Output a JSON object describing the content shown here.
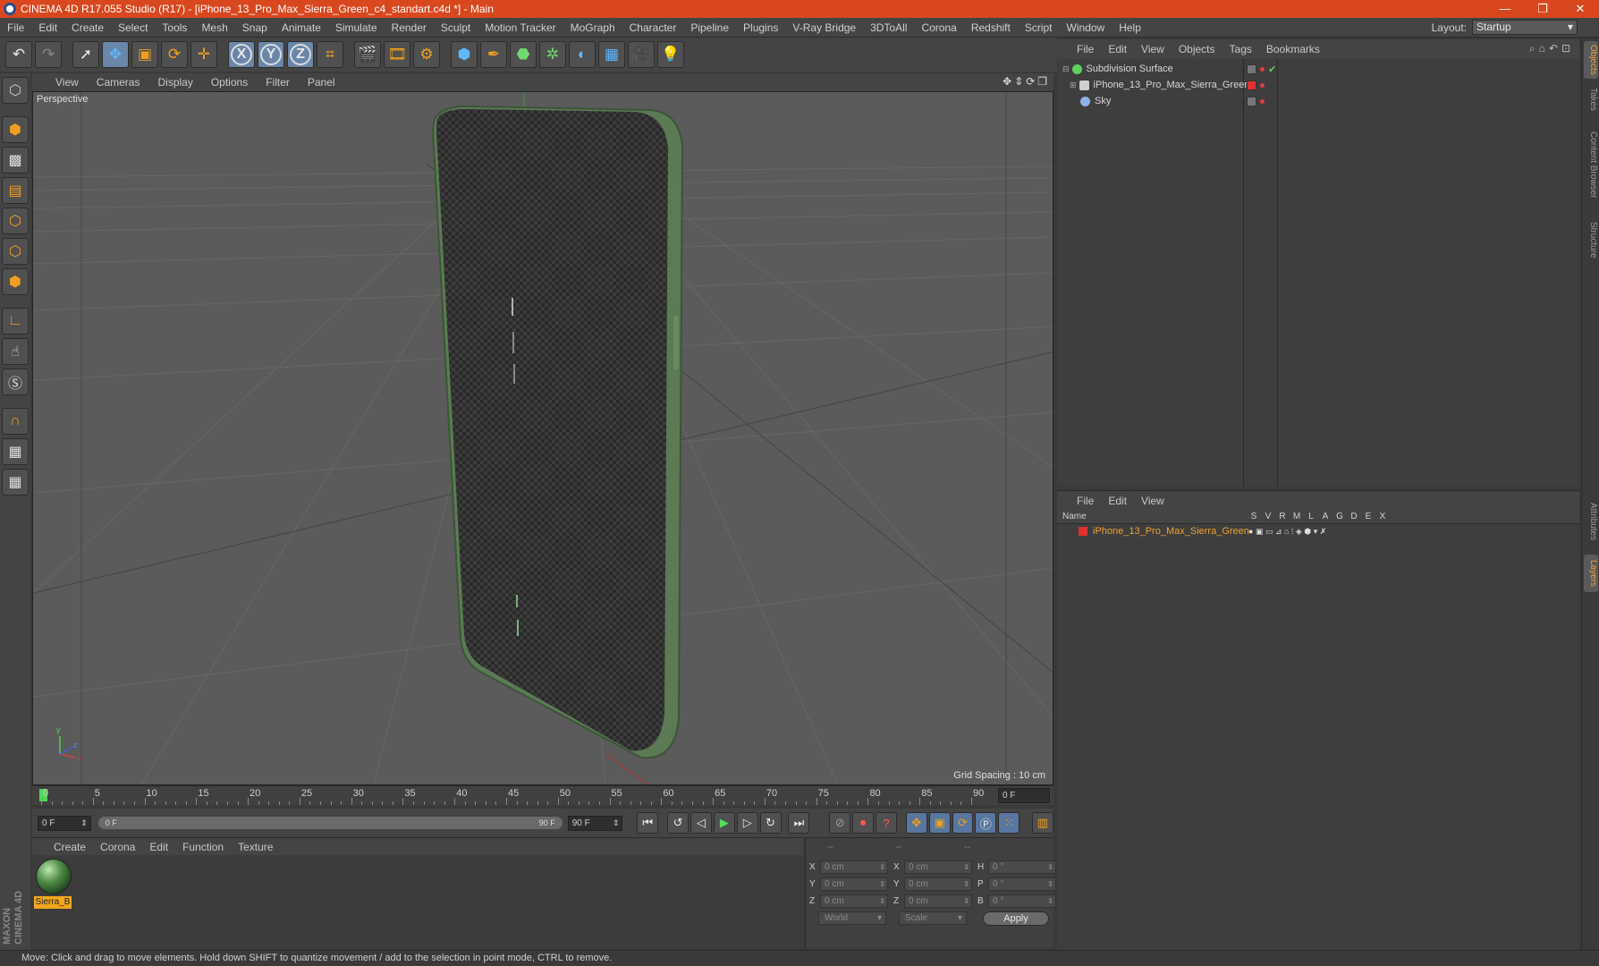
{
  "window": {
    "title": "CINEMA 4D R17.055 Studio (R17) - [iPhone_13_Pro_Max_Sierra_Green_c4_standart.c4d *] - Main",
    "minimize": "—",
    "restore": "❐",
    "close": "✕"
  },
  "menubar": {
    "items": [
      "File",
      "Edit",
      "Create",
      "Select",
      "Tools",
      "Mesh",
      "Snap",
      "Animate",
      "Simulate",
      "Render",
      "Sculpt",
      "Motion Tracker",
      "MoGraph",
      "Character",
      "Pipeline",
      "Plugins",
      "V-Ray Bridge",
      "3DToAll",
      "Corona",
      "Redshift",
      "Script",
      "Window",
      "Help"
    ],
    "layout_label": "Layout:",
    "layout_value": "Startup"
  },
  "toolbar": {
    "icons": [
      "undo-icon",
      "redo-icon",
      "select-icon",
      "move-icon",
      "scale-icon",
      "rotate-icon",
      "live-move-icon",
      "x-axis-icon",
      "y-axis-icon",
      "z-axis-icon",
      "world-coords-icon",
      "render-view-icon",
      "render-picture-queue-icon",
      "render-settings-icon",
      "cube-icon",
      "pen-icon",
      "subdivision-icon",
      "array-icon",
      "deformer-icon",
      "floor-icon",
      "camera-icon",
      "light-icon"
    ],
    "axis_labels": [
      "X",
      "Y",
      "Z"
    ]
  },
  "viewport": {
    "menu": [
      "View",
      "Cameras",
      "Display",
      "Options",
      "Filter",
      "Panel"
    ],
    "label": "Perspective",
    "grid_spacing": "Grid Spacing : 10 cm",
    "axis_y": "y",
    "axis_x": "x",
    "axis_z": "z"
  },
  "timeline": {
    "ticks": [
      "0",
      "5",
      "10",
      "15",
      "20",
      "25",
      "30",
      "35",
      "40",
      "45",
      "50",
      "55",
      "60",
      "65",
      "70",
      "75",
      "80",
      "85",
      "90"
    ],
    "current_frame": "0 F"
  },
  "playback": {
    "start_field": "0 F",
    "range_start": "0 F",
    "range_end": "90 F",
    "end_field": "90 F"
  },
  "material_manager": {
    "menu": [
      "Create",
      "Corona",
      "Edit",
      "Function",
      "Texture"
    ],
    "material_name": "Sierra_B"
  },
  "coordinates": {
    "header": [
      "--",
      "--",
      "--"
    ],
    "rows": [
      {
        "a": "X",
        "av": "0 cm",
        "b": "X",
        "bv": "0 cm",
        "c": "H",
        "cv": "0 °"
      },
      {
        "a": "Y",
        "av": "0 cm",
        "b": "Y",
        "bv": "0 cm",
        "c": "P",
        "cv": "0 °"
      },
      {
        "a": "Z",
        "av": "0 cm",
        "b": "Z",
        "bv": "0 cm",
        "c": "B",
        "cv": "0 °"
      }
    ],
    "mode": "World",
    "type": "Scale",
    "apply": "Apply"
  },
  "object_manager": {
    "menu": [
      "File",
      "Edit",
      "View",
      "Objects",
      "Tags",
      "Bookmarks"
    ],
    "objects": [
      {
        "name": "Subdivision Surface",
        "color": "#5fd05f"
      },
      {
        "name": "iPhone_13_Pro_Max_Sierra_Green",
        "color": "#cfcfcf"
      },
      {
        "name": "Sky",
        "color": "#8ab4e6"
      }
    ]
  },
  "layer_manager": {
    "menu": [
      "File",
      "Edit",
      "View"
    ],
    "columns": [
      "Name",
      "S",
      "V",
      "R",
      "M",
      "L",
      "A",
      "G",
      "D",
      "E",
      "X"
    ],
    "layer_name": "iPhone_13_Pro_Max_Sierra_Green",
    "layer_color": "#e03030"
  },
  "side_tabs": [
    "Objects",
    "Takes",
    "Content Browser",
    "Structure",
    "Attributes",
    "Layers"
  ],
  "maxon_logo": "MAXON CINEMA 4D",
  "status": "Move: Click and drag to move elements. Hold down SHIFT to quantize movement / add to the selection in point mode, CTRL to remove."
}
